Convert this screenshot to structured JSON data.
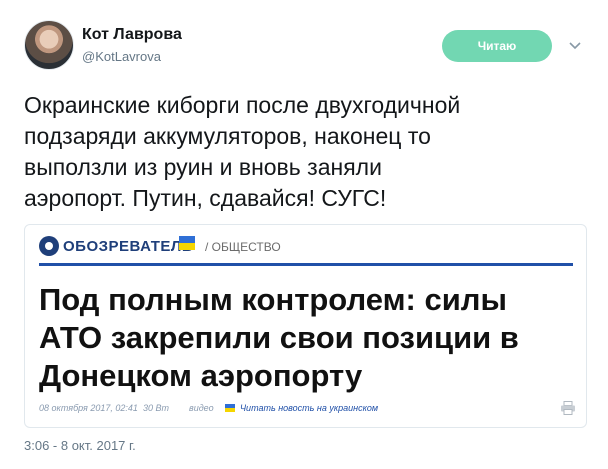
{
  "header": {
    "display_name": "Кот Лаврова",
    "handle": "@KotLavrova",
    "follow_button_label": "Читаю",
    "avatar_icon": "user-avatar",
    "more_icon": "chevron-down-icon"
  },
  "tweet": {
    "text": "Окраинские киборги после двухгодичной\nподзаряди аккумуляторов,  наконец то\nвыползли из руин и вновь заняли\nаэропорт. Путин, сдавайся! СУГС!",
    "timestamp": "3:06 - 8 окт. 2017 г."
  },
  "card": {
    "site_name": "ОБОЗРЕВАТЕЛЬ",
    "section": "/ ОБЩЕСТВО",
    "headline": "Под полным контролем: силы АТО закрепили свои позиции в Донецком аэропорту",
    "meta": {
      "date": "08 октября 2017, 02:41",
      "views": "30 Вт",
      "video": "видео",
      "translate_link": "Читать новость на украинском"
    },
    "colors": {
      "brand": "#1f3f7a",
      "rule": "#2050a8",
      "flag_blue": "#2f6fd6",
      "flag_yellow": "#f5d600"
    }
  },
  "colors": {
    "follow_button": "#72d7b2",
    "muted_text": "#657786"
  }
}
